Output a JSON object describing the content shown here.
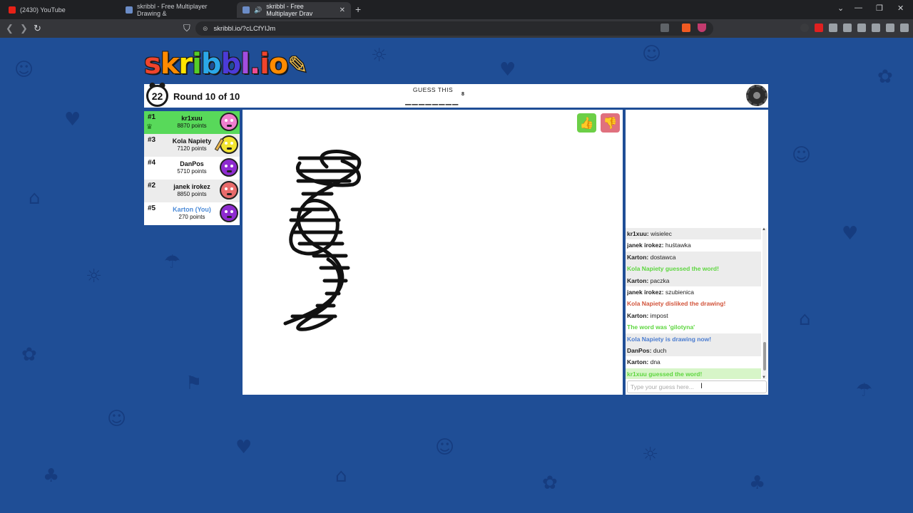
{
  "browser": {
    "tabs": [
      {
        "title": "(2430) YouTube",
        "icon": "youtube-icon",
        "active": false
      },
      {
        "title": "skribbl - Free Multiplayer Drawing &",
        "icon": "skribbl-icon",
        "active": false
      },
      {
        "title": "skribbl - Free Multiplayer Drav",
        "icon": "skribbl-icon",
        "active": true
      }
    ],
    "new_tab": "+",
    "url": "skribbl.io/?cLCfYIJm",
    "window_controls": {
      "dropdown": "⌄",
      "minimize": "—",
      "restore": "❐",
      "close": "✕"
    },
    "nav": {
      "back": "❮",
      "forward": "❯",
      "reload": "↻"
    }
  },
  "game": {
    "logo": {
      "text": "skribbl.io",
      "colors": [
        "#f0442c",
        "#ff8b00",
        "#ffe300",
        "#56ce27",
        "#2ba8e8",
        "#4c3bd8",
        "#a24de0",
        "#ee4b91",
        "#f0442c",
        "#ff8b00"
      ]
    },
    "timer": "22",
    "round": "Round 10 of 10",
    "guess_label": "GUESS THIS",
    "word_pattern": "________",
    "word_length": "8"
  },
  "players": [
    {
      "rank": "#1",
      "name": "kr1xuu",
      "points": "8870 points",
      "style": "guessed",
      "avatar_color": "#f07fcf",
      "crown": true,
      "you": false
    },
    {
      "rank": "#3",
      "name": "Kola Napiety",
      "points": "7120 points",
      "style": "alt",
      "avatar_color": "#f2e431",
      "drawing": true,
      "you": false
    },
    {
      "rank": "#4",
      "name": "DanPos",
      "points": "5710 points",
      "style": "normal",
      "avatar_color": "#8e2bd0",
      "you": false
    },
    {
      "rank": "#2",
      "name": "janek irokez",
      "points": "8850 points",
      "style": "alt",
      "avatar_color": "#e86b6b",
      "you": false
    },
    {
      "rank": "#5",
      "name": "Karton (You)",
      "points": "270 points",
      "style": "normal",
      "avatar_color": "#8e2bd0",
      "you": true
    }
  ],
  "chat": {
    "messages": [
      {
        "author": "kr1xuu",
        "text": "wisielec",
        "type": "user"
      },
      {
        "author": "janek irokez",
        "text": "huśtawka",
        "type": "user"
      },
      {
        "author": "Karton",
        "text": "dostawca",
        "type": "user"
      },
      {
        "author": "",
        "text": "Kola Napiety guessed the word!",
        "type": "sys-green"
      },
      {
        "author": "Karton",
        "text": "paczka",
        "type": "user"
      },
      {
        "author": "janek irokez",
        "text": "szubienica",
        "type": "user"
      },
      {
        "author": "",
        "text": "Kola Napiety disliked the drawing!",
        "type": "sys-red"
      },
      {
        "author": "Karton",
        "text": "impost",
        "type": "user"
      },
      {
        "author": "",
        "text": "The word was 'gilotyna'",
        "type": "sys-green"
      },
      {
        "author": "",
        "text": "Kola Napiety is drawing now!",
        "type": "sys-blue"
      },
      {
        "author": "DanPos",
        "text": "duch",
        "type": "user"
      },
      {
        "author": "Karton",
        "text": "dna",
        "type": "user"
      },
      {
        "author": "",
        "text": "kr1xuu guessed the word!",
        "type": "sys-green"
      }
    ],
    "input_placeholder": "Type your guess here..."
  },
  "canvas": {
    "drawing": "dna-helix-sketch",
    "like_icon": "thumbs-up-icon",
    "dislike_icon": "thumbs-down-icon"
  }
}
